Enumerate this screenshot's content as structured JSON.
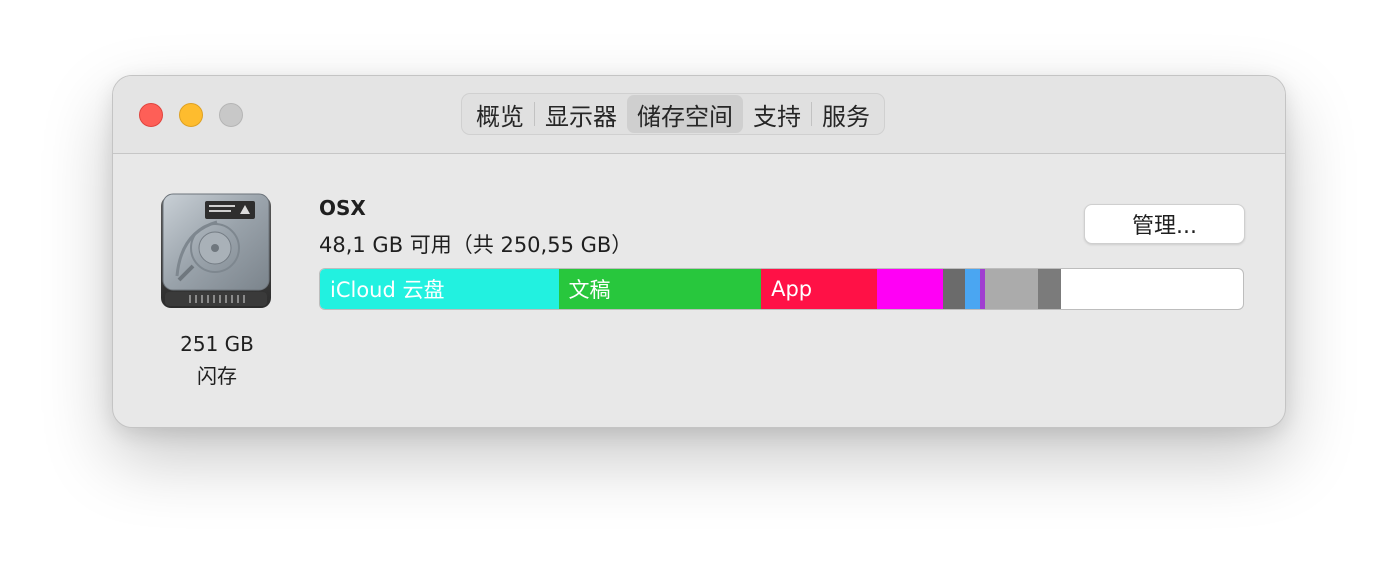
{
  "tabs": [
    {
      "label": "概览"
    },
    {
      "label": "显示器"
    },
    {
      "label": "储存空间"
    },
    {
      "label": "支持"
    },
    {
      "label": "服务"
    }
  ],
  "active_tab": "储存空间",
  "disk": {
    "capacity": "251 GB",
    "type": "闪存",
    "icon": "hard-drive-icon"
  },
  "volume": {
    "name": "OSX",
    "info": "48,1 GB 可用（共 250,55 GB）"
  },
  "manage_label": "管理...",
  "storage_segments": [
    {
      "label": "iCloud 云盘",
      "color": "#22f1e0",
      "fraction": 0.2584
    },
    {
      "label": "文稿",
      "color": "#28c73d",
      "fraction": 0.2195
    },
    {
      "label": "App",
      "color": "#ff1146",
      "fraction": 0.1254
    },
    {
      "label": "",
      "color": "#ff00f5",
      "fraction": 0.0714
    },
    {
      "label": "",
      "color": "#6b6b6b",
      "fraction": 0.0238
    },
    {
      "label": "",
      "color": "#4aa6f2",
      "fraction": 0.0162
    },
    {
      "label": "",
      "color": "#a03ed0",
      "fraction": 0.0054
    },
    {
      "label": "",
      "color": "#ababab",
      "fraction": 0.0584
    },
    {
      "label": "",
      "color": "#7b7b7b",
      "fraction": 0.0249
    }
  ],
  "free_color": "#ffffff"
}
